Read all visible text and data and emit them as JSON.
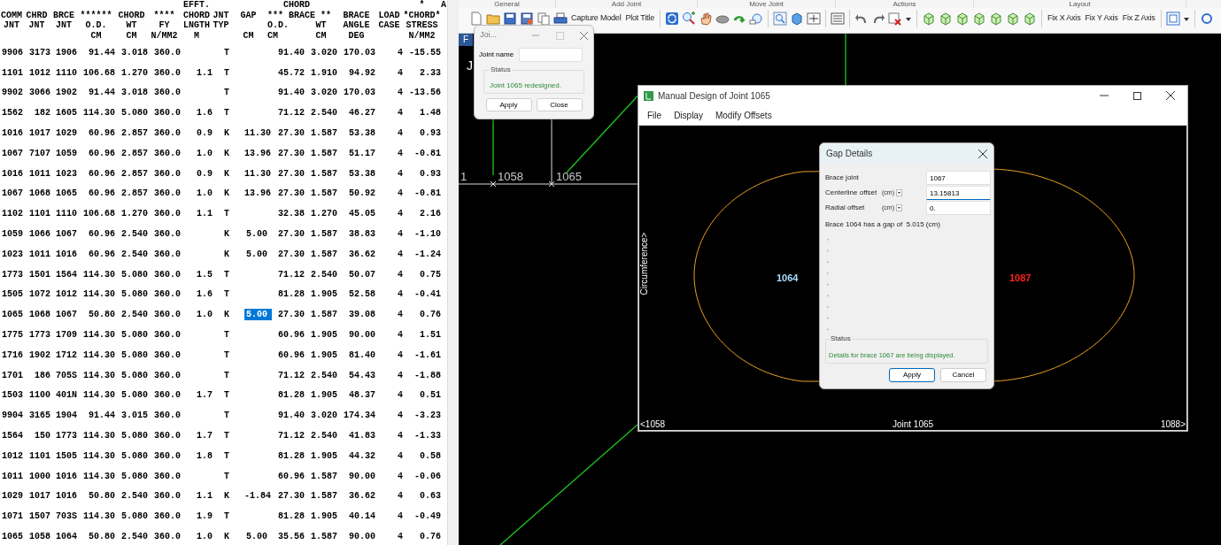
{
  "data_table": {
    "columns": [
      {
        "line_2": "COMM",
        "line_3": "JNT"
      },
      {
        "line_2": "CHRD",
        "line_3": "JNT"
      },
      {
        "line_2": "BRCE",
        "line_3": "JNT"
      },
      {
        "line_2": "******",
        "line_3": "O.D.",
        "line_4": "CM"
      },
      {
        "line_2": "CHORD",
        "line_3": "WT",
        "line_4": "CM"
      },
      {
        "line_2": "****",
        "line_3": "FY",
        "line_4": "N/MM2"
      },
      {
        "line_1": "EFFT.",
        "line_2": "CHORD",
        "line_3": "LNGTH",
        "line_4": "M"
      },
      {
        "line_2": "JNT",
        "line_3": "TYP"
      },
      {
        "line_2": "GAP",
        "line_4": "CM"
      },
      {
        "line_1": "CHORD",
        "line_2": "*** BRACE **",
        "line_3": "O.D.",
        "line_4": "CM"
      },
      {
        "line_3": "WT",
        "line_4": "CM"
      },
      {
        "line_2": "BRACE",
        "line_3": "ANGLE",
        "line_4": "DEG"
      },
      {
        "line_2": "LOAD",
        "line_3": "CASE"
      },
      {
        "line_1": "*",
        "line_2": "*CHORD*",
        "line_3": "STRESS",
        "line_4": "N/MM2"
      },
      {
        "line_1": "A"
      }
    ],
    "rows": [
      {
        "cells": [
          "9906",
          "3173",
          "1906",
          "91.44",
          "3.018",
          "360.0",
          null,
          "T",
          null,
          "91.40",
          "3.020",
          "170.03",
          "4",
          "-15.55"
        ],
        "gap_selected": false
      },
      {
        "cells": [
          "1101",
          "1012",
          "1110",
          "106.68",
          "1.270",
          "360.0",
          "1.1",
          "T",
          null,
          "45.72",
          "1.910",
          "94.92",
          "4",
          "2.33"
        ],
        "gap_selected": false
      },
      {
        "cells": [
          "9902",
          "3066",
          "1902",
          "91.44",
          "3.018",
          "360.0",
          null,
          "T",
          null,
          "91.40",
          "3.020",
          "170.03",
          "4",
          "-13.56"
        ],
        "gap_selected": false
      },
      {
        "cells": [
          "1562",
          "182",
          "1605",
          "114.30",
          "5.080",
          "360.0",
          "1.6",
          "T",
          null,
          "71.12",
          "2.540",
          "46.27",
          "4",
          "1.48"
        ],
        "gap_selected": false
      },
      {
        "cells": [
          "1016",
          "1017",
          "1029",
          "60.96",
          "2.857",
          "360.0",
          "0.9",
          "K",
          "11.30",
          "27.30",
          "1.587",
          "53.38",
          "4",
          "0.93"
        ],
        "gap_selected": false
      },
      {
        "cells": [
          "1067",
          "7107",
          "1059",
          "60.96",
          "2.857",
          "360.0",
          "1.0",
          "K",
          "13.96",
          "27.30",
          "1.587",
          "51.17",
          "4",
          "-0.81"
        ],
        "gap_selected": false
      },
      {
        "cells": [
          "1016",
          "1011",
          "1023",
          "60.96",
          "2.857",
          "360.0",
          "0.9",
          "K",
          "11.30",
          "27.30",
          "1.587",
          "53.38",
          "4",
          "0.93"
        ],
        "gap_selected": false
      },
      {
        "cells": [
          "1067",
          "1068",
          "1065",
          "60.96",
          "2.857",
          "360.0",
          "1.0",
          "K",
          "13.96",
          "27.30",
          "1.587",
          "50.92",
          "4",
          "-0.81"
        ],
        "gap_selected": false
      },
      {
        "cells": [
          "1102",
          "1101",
          "1110",
          "106.68",
          "1.270",
          "360.0",
          "1.1",
          "T",
          null,
          "32.38",
          "1.270",
          "45.05",
          "4",
          "2.16"
        ],
        "gap_selected": false
      },
      {
        "cells": [
          "1059",
          "1066",
          "1067",
          "60.96",
          "2.540",
          "360.0",
          null,
          "K",
          "5.00",
          "27.30",
          "1.587",
          "38.83",
          "4",
          "-1.10"
        ],
        "gap_selected": false
      },
      {
        "cells": [
          "1023",
          "1011",
          "1016",
          "60.96",
          "2.540",
          "360.0",
          null,
          "K",
          "5.00",
          "27.30",
          "1.587",
          "36.62",
          "4",
          "-1.24"
        ],
        "gap_selected": false
      },
      {
        "cells": [
          "1773",
          "1501",
          "1564",
          "114.30",
          "5.080",
          "360.0",
          "1.5",
          "T",
          null,
          "71.12",
          "2.540",
          "50.07",
          "4",
          "0.75"
        ],
        "gap_selected": false
      },
      {
        "cells": [
          "1505",
          "1072",
          "1012",
          "114.30",
          "5.080",
          "360.0",
          "1.6",
          "T",
          null,
          "81.28",
          "1.905",
          "52.58",
          "4",
          "-0.41"
        ],
        "gap_selected": false
      },
      {
        "cells": [
          "1065",
          "1068",
          "1067",
          "50.80",
          "2.540",
          "360.0",
          "1.0",
          "K",
          "5.00",
          "27.30",
          "1.587",
          "39.08",
          "4",
          "0.76"
        ],
        "gap_selected": true
      },
      {
        "cells": [
          "1775",
          "1773",
          "1709",
          "114.30",
          "5.080",
          "360.0",
          null,
          "T",
          null,
          "60.96",
          "1.905",
          "90.00",
          "4",
          "1.51"
        ],
        "gap_selected": false
      },
      {
        "cells": [
          "1716",
          "1902",
          "1712",
          "114.30",
          "5.080",
          "360.0",
          null,
          "T",
          null,
          "60.96",
          "1.905",
          "81.40",
          "4",
          "-1.61"
        ],
        "gap_selected": false
      },
      {
        "cells": [
          "1701",
          "186",
          "705S",
          "114.30",
          "5.080",
          "360.0",
          null,
          "T",
          null,
          "71.12",
          "2.540",
          "54.43",
          "4",
          "-1.88"
        ],
        "gap_selected": false
      },
      {
        "cells": [
          "1503",
          "1100",
          "401N",
          "114.30",
          "5.080",
          "360.0",
          "1.7",
          "T",
          null,
          "81.28",
          "1.905",
          "48.37",
          "4",
          "0.51"
        ],
        "gap_selected": false
      },
      {
        "cells": [
          "9904",
          "3165",
          "1904",
          "91.44",
          "3.015",
          "360.0",
          null,
          "T",
          null,
          "91.40",
          "3.020",
          "174.34",
          "4",
          "-3.23"
        ],
        "gap_selected": false
      },
      {
        "cells": [
          "1564",
          "150",
          "1773",
          "114.30",
          "5.080",
          "360.0",
          "1.7",
          "T",
          null,
          "71.12",
          "2.540",
          "41.83",
          "4",
          "-1.33"
        ],
        "gap_selected": false
      },
      {
        "cells": [
          "1012",
          "1101",
          "1505",
          "114.30",
          "5.080",
          "360.0",
          "1.8",
          "T",
          null,
          "81.28",
          "1.905",
          "44.32",
          "4",
          "0.58"
        ],
        "gap_selected": false
      },
      {
        "cells": [
          "1011",
          "1000",
          "1016",
          "114.30",
          "5.080",
          "360.0",
          null,
          "T",
          null,
          "60.96",
          "1.587",
          "90.00",
          "4",
          "-0.06"
        ],
        "gap_selected": false
      },
      {
        "cells": [
          "1029",
          "1017",
          "1016",
          "50.80",
          "2.540",
          "360.0",
          "1.1",
          "K",
          "-1.84",
          "27.30",
          "1.587",
          "36.62",
          "4",
          "0.63"
        ],
        "gap_selected": false
      },
      {
        "cells": [
          "1071",
          "1507",
          "703S",
          "114.30",
          "5.080",
          "360.0",
          "1.9",
          "T",
          null,
          "81.28",
          "1.905",
          "40.14",
          "4",
          "-0.49"
        ],
        "gap_selected": false
      },
      {
        "cells": [
          "1065",
          "1058",
          "1064",
          "50.80",
          "2.540",
          "360.0",
          "1.0",
          "K",
          "5.00",
          "35.56",
          "1.587",
          "90.00",
          "4",
          "0.76"
        ],
        "gap_selected": false
      }
    ]
  },
  "ribbon": {
    "groups": [
      "General",
      "Add Joint",
      "Move Joint",
      "Actions",
      "Layout"
    ]
  },
  "toolbar": {
    "text_buttons": [
      "Capture Model",
      "Plot Title",
      "Fix X Axis",
      "Fix Y Axis",
      "Fix Z Axis"
    ]
  },
  "viewport": {
    "tab": "F",
    "label": "J",
    "node_labels": [
      "1",
      "1058",
      "1065"
    ]
  },
  "joint_dialog": {
    "title": "Joi...",
    "field_label": "Joint name",
    "status_title": "Status",
    "status_text": "Joint 1065 redesigned.",
    "buttons": [
      "Apply",
      "Close"
    ]
  },
  "design_window": {
    "title": "Manual Design of Joint 1065",
    "menu": [
      "File",
      "Display",
      "Modify Offsets"
    ],
    "brace_labels": [
      {
        "text": "1064",
        "color": "#a8dcff"
      },
      {
        "text": "1087",
        "color": "#ff2222"
      }
    ],
    "axis_label": "Circumference>",
    "bottom_labels": [
      "<1058",
      "Joint 1065",
      "1088>"
    ]
  },
  "gap_dialog": {
    "title": "Gap Details",
    "fields": [
      {
        "label": "Brace joint",
        "value": "1067",
        "focused": false
      },
      {
        "label": "Centerline offset",
        "unit": "(cm)",
        "value": "13.15813",
        "focused": true
      },
      {
        "label": "Radial offset",
        "unit": "(cm)",
        "value": "0.",
        "focused": false
      }
    ],
    "message": "Brace 1064 has a gap of  5.015 (cm)",
    "status_title": "Status",
    "status_text": "Details for brace 1067 are being displayed.",
    "buttons": [
      {
        "label": "Apply",
        "default": true
      },
      {
        "label": "Cancel",
        "default": false
      }
    ]
  }
}
